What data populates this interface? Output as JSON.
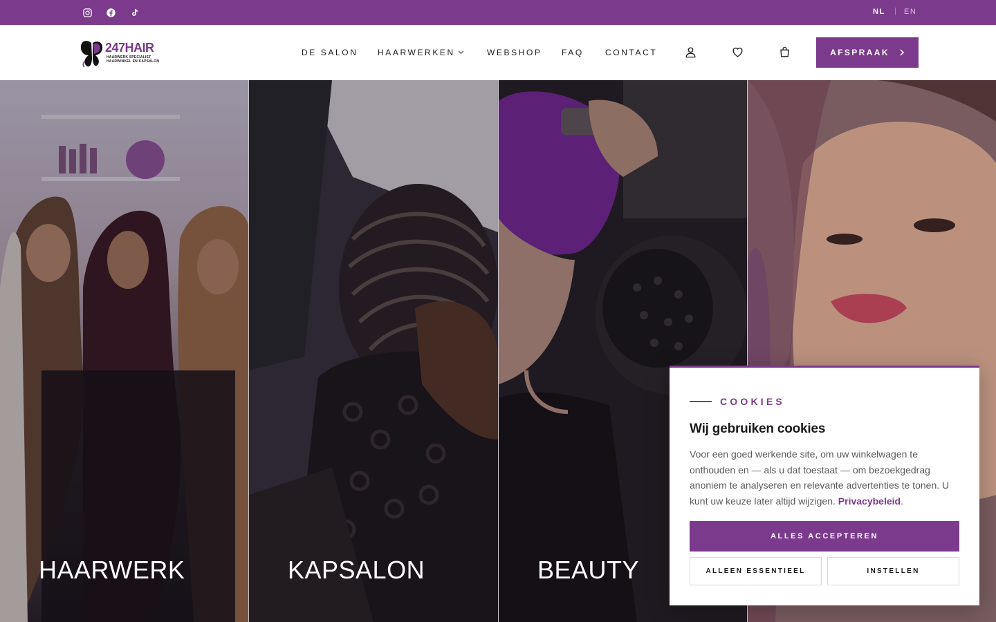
{
  "topbar": {
    "social": [
      {
        "icon": "instagram-icon"
      },
      {
        "icon": "facebook-icon"
      },
      {
        "icon": "tiktok-icon"
      }
    ],
    "languages": [
      "NL",
      "EN"
    ],
    "language_separator": "|",
    "active_language": "NL"
  },
  "header": {
    "logo": {
      "text": "247HAIR",
      "sub1": "HAARWERK SPECIALIST",
      "sub2": "HAARWINKEL EN KAPSALON"
    },
    "nav": [
      "DE SALON",
      "HAARWERKEN",
      "WEBSHOP",
      "FAQ",
      "CONTACT"
    ],
    "icons": [
      "account-icon",
      "wishlist-heart-icon",
      "shopping-bag-icon"
    ],
    "cta_label": "AFSPRAAK"
  },
  "panels": [
    {
      "label": "HAARWERK"
    },
    {
      "label": "KAPSALON"
    },
    {
      "label": "BEAUTY"
    },
    {
      "label": ""
    }
  ],
  "cookie": {
    "eyebrow": "COOKIES",
    "title": "Wij gebruiken cookies",
    "body": "Voor een goed werkende site, om uw winkelwagen te onthouden en — als u dat toestaat — om bezoekgedrag anoniem te analyseren en relevante advertenties te tonen. U kunt uw keuze later altijd wijzigen.",
    "link": "Privacybeleid",
    "link_suffix": ".",
    "accept_all": "ALLES ACCEPTEREN",
    "essential_only": "ALLEEN ESSENTIEEL",
    "settings": "INSTELLEN"
  },
  "colors": {
    "brand": "#7b3a8c",
    "white": "#ffffff",
    "text": "#1c1c1c"
  }
}
